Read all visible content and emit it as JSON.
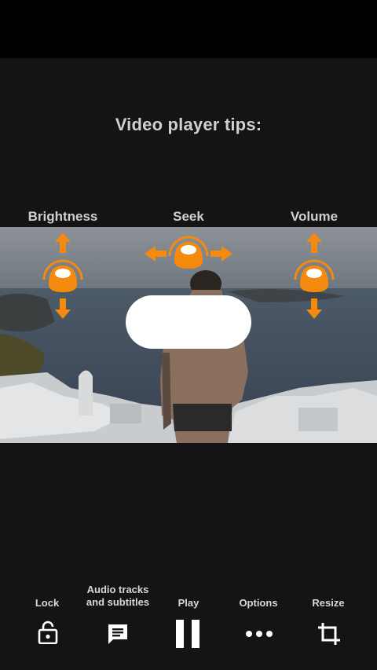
{
  "tips": {
    "title": "Video player tips:",
    "gestures": {
      "brightness": "Brightness",
      "seek": "Seek",
      "volume": "Volume"
    }
  },
  "controls": {
    "lock_label": "Lock",
    "audio_label_line1": "Audio tracks",
    "audio_label_line2": "and subtitles",
    "play_label": "Play",
    "options_label": "Options",
    "resize_label": "Resize"
  },
  "icons": {
    "gesture_icon": "finger-swipe-icon",
    "lock": "lock-icon",
    "audio": "subtitles-icon",
    "play": "pause-icon",
    "options": "more-dots-icon",
    "resize": "crop-icon"
  },
  "colors": {
    "accent": "#F58A0E",
    "background": "#141414",
    "text": "#D0D0D0"
  }
}
